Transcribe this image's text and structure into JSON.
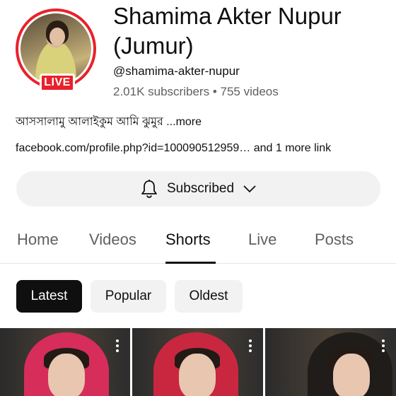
{
  "channel": {
    "name": "Shamima Akter Nupur (Jumur)",
    "handle": "@shamima-akter-nupur",
    "subscribers": "2.01K subscribers",
    "separator": "•",
    "videos": "755 videos",
    "live_badge": "LIVE",
    "description": "আসসালামু আলাইকুম  আমি ঝুমুর",
    "description_more": "...more",
    "link": "facebook.com/profile.php?id=100090512959…",
    "link_more": "and 1 more link"
  },
  "subscribe": {
    "label": "Subscribed",
    "icon_bell": "bell-icon",
    "icon_chevron": "chevron-down-icon"
  },
  "tabs": [
    {
      "label": "Home",
      "active": false
    },
    {
      "label": "Videos",
      "active": false
    },
    {
      "label": "Shorts",
      "active": true
    },
    {
      "label": "Live",
      "active": false
    },
    {
      "label": "Posts",
      "active": false
    }
  ],
  "filters": [
    {
      "label": "Latest",
      "active": true
    },
    {
      "label": "Popular",
      "active": false
    },
    {
      "label": "Oldest",
      "active": false
    }
  ],
  "colors": {
    "live_red": "#e8212b",
    "text_primary": "#0f0f0f",
    "text_secondary": "#606060",
    "chip_bg": "#f2f2f2"
  }
}
